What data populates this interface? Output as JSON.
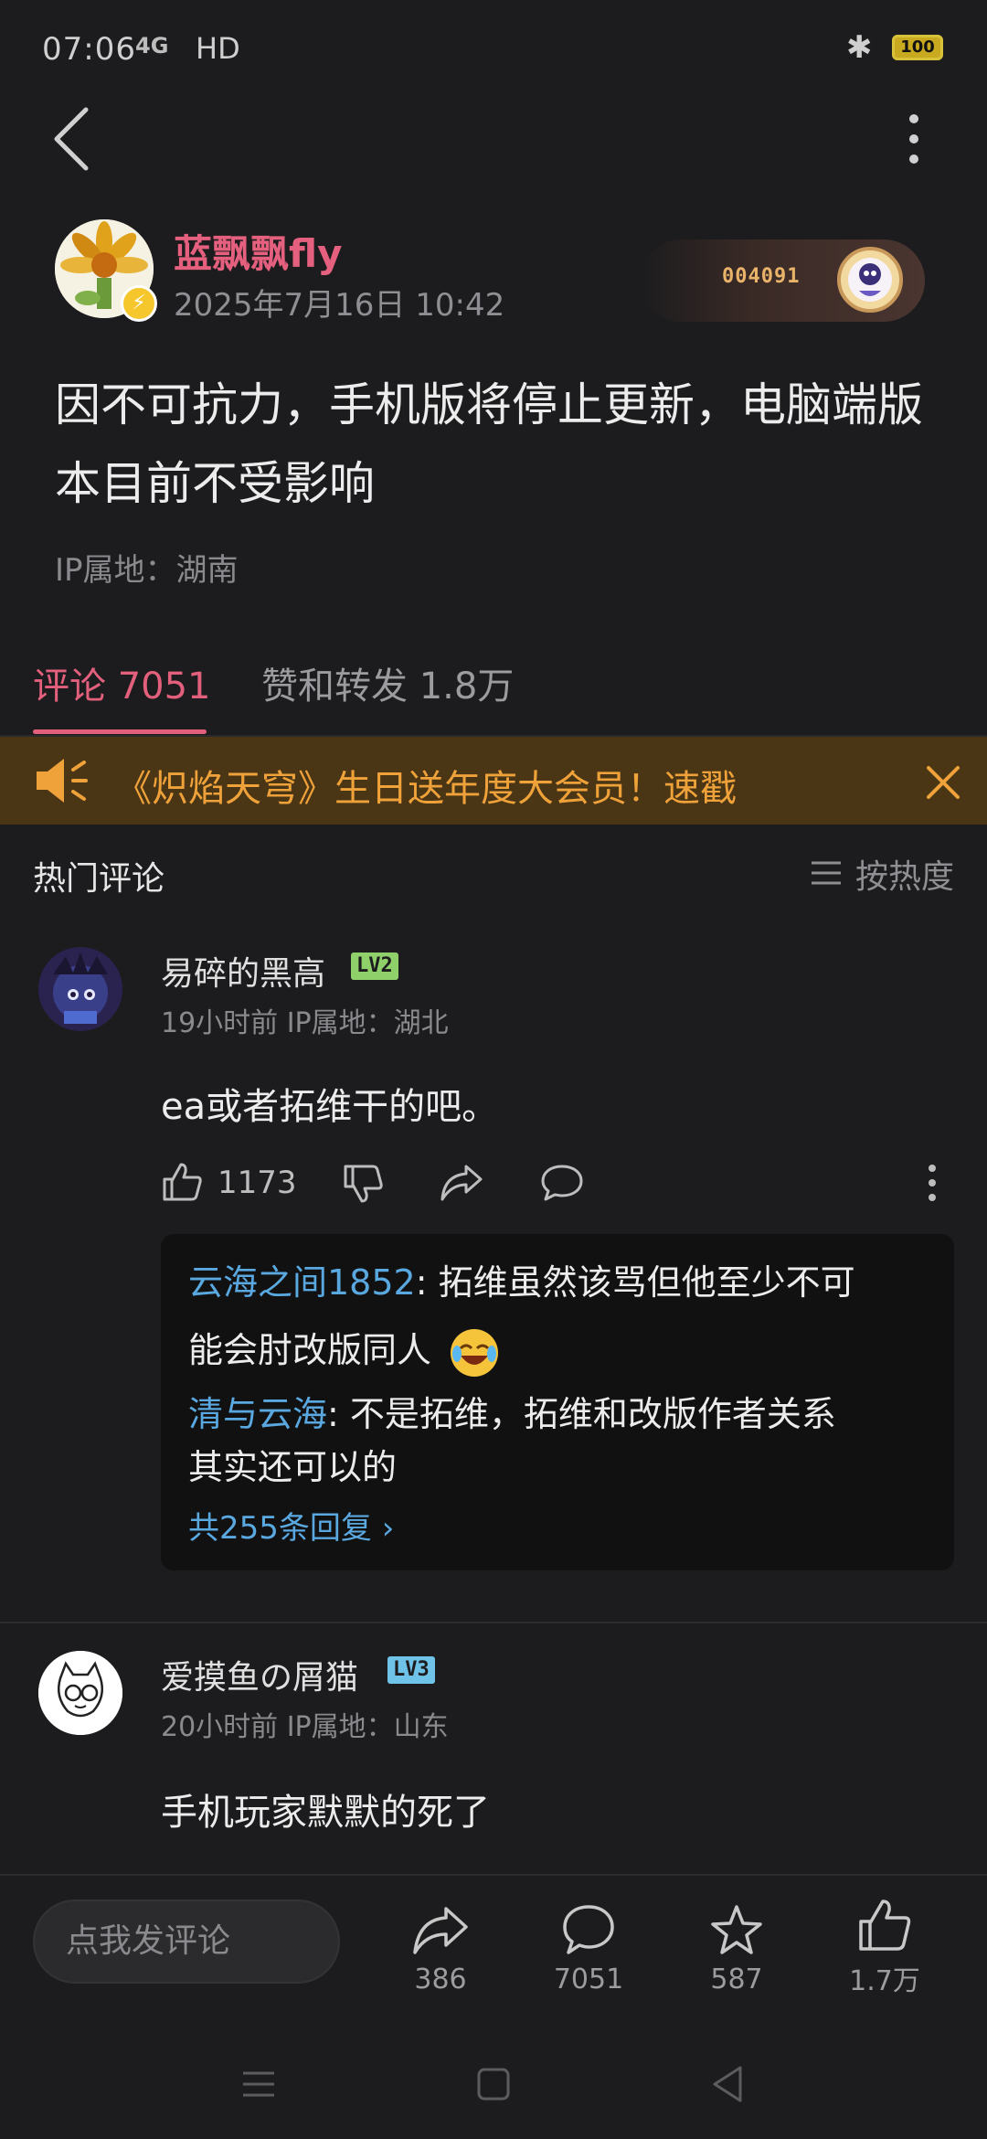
{
  "status_bar": {
    "time": "07:06",
    "network": "4G",
    "hd": "HD",
    "battery": "100"
  },
  "post": {
    "author": "蓝飘飘fly",
    "time": "2025年7月16日 10:42",
    "card_number": "004091",
    "content": "因不可抗力，手机版将停止更新，电脑端版本目前不受影响",
    "ip": "IP属地：湖南"
  },
  "tabs": {
    "comments": "评论 7051",
    "likes": "赞和转发 1.8万"
  },
  "banner": {
    "text": "《炽焰天穹》生日送年度大会员！速戳"
  },
  "comments_section": {
    "title": "热门评论",
    "sort_label": "按热度"
  },
  "comments": [
    {
      "name": "易碎的黑高",
      "level": "LV2",
      "meta": "19小时前 IP属地：湖北",
      "text": "ea或者拓维干的吧。",
      "like_count": "1173",
      "replies": [
        {
          "name": "云海之间1852",
          "text": ": 拓维虽然该骂但他至少不可",
          "cont": "能会肘改版同人"
        },
        {
          "name": "清与云海",
          "text": ": 不是拓维，拓维和改版作者关系",
          "cont": "其实还可以的"
        }
      ],
      "more_replies": "共255条回复 ›"
    },
    {
      "name": "爱摸鱼の屑猫",
      "level": "LV3",
      "meta": "20小时前 IP属地：山东",
      "text": "手机玩家默默的死了"
    }
  ],
  "bottom_bar": {
    "input_placeholder": "点我发评论",
    "share_count": "386",
    "comment_count": "7051",
    "fav_count": "587",
    "like_count": "1.7万"
  },
  "colors": {
    "accent_pink": "#e2607c",
    "banner_orange": "#f0a23a",
    "reply_blue": "#5aa8e0",
    "lv2_green": "#8fd06a",
    "lv3_blue": "#6fc3e8"
  }
}
